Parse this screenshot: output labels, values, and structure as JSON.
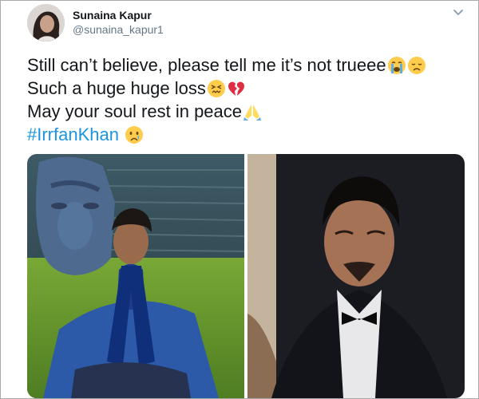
{
  "user": {
    "display_name": "Sunaina Kapur",
    "handle": "@sunaina_kapur1"
  },
  "tweet": {
    "lines": [
      "Still can’t believe, please tell me it’s not trueee",
      "Such a huge huge loss",
      "May your soul rest in peace"
    ],
    "hashtag": "#IrrfanKhan"
  },
  "icons": {
    "caret": "chevron-down-icon",
    "emoji_line1": [
      "loudly-crying-face-emoji",
      "disappointed-face-emoji"
    ],
    "emoji_line2": [
      "persevering-face-emoji",
      "broken-heart-emoji"
    ],
    "emoji_line3": [
      "folded-hands-emoji"
    ],
    "emoji_line4": [
      "crying-face-emoji"
    ]
  },
  "colors": {
    "text": "#14171a",
    "secondary": "#657786",
    "link": "#1b95e0",
    "border": "#a9a9a9"
  }
}
